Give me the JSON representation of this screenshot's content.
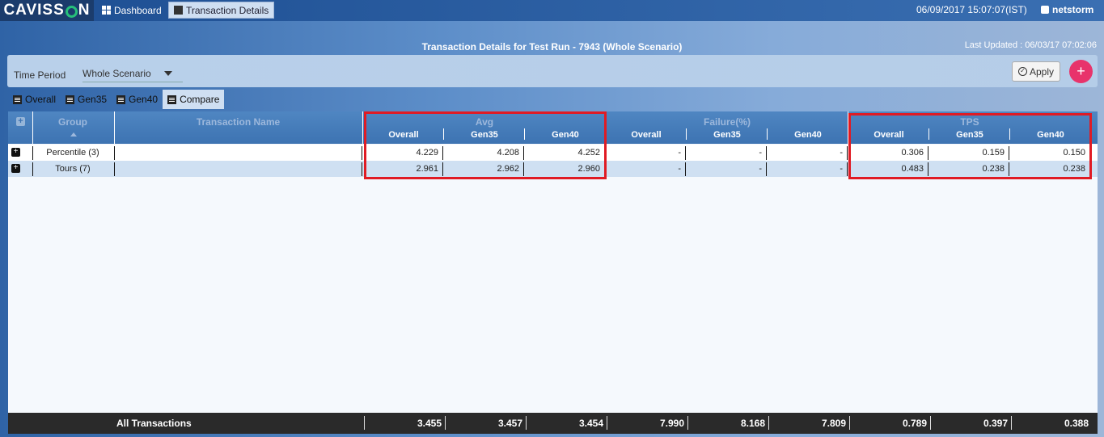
{
  "app": {
    "logo_text_1": "CAVISS",
    "logo_text_2": "N",
    "nav_tabs": [
      {
        "label": "Dashboard",
        "icon": "dashboard-grid-icon"
      },
      {
        "label": "Transaction Details",
        "icon": "comment-icon"
      }
    ],
    "datetime": "06/09/2017 15:07:07(IST)",
    "user": "netstorm"
  },
  "page": {
    "title": "Transaction Details for Test Run - 7943 (Whole Scenario)",
    "last_updated": "Last Updated : 06/03/17 07:02:06"
  },
  "filter": {
    "time_period_label": "Time Period",
    "time_period_value": "Whole Scenario",
    "apply_label": "Apply",
    "add_label": "+"
  },
  "subtabs": [
    {
      "label": "Overall"
    },
    {
      "label": "Gen35"
    },
    {
      "label": "Gen40"
    },
    {
      "label": "Compare",
      "active": true
    }
  ],
  "table": {
    "col_group": "Group",
    "col_name": "Transaction Name",
    "groups": [
      "Avg",
      "Failure(%)",
      "TPS"
    ],
    "sub_cols": [
      "Overall",
      "Gen35",
      "Gen40"
    ],
    "rows": [
      {
        "group": "Percentile (3)",
        "name": "",
        "avg": [
          "4.229",
          "4.208",
          "4.252"
        ],
        "fail": [
          "-",
          "-",
          "-"
        ],
        "tps": [
          "0.306",
          "0.159",
          "0.150"
        ]
      },
      {
        "group": "Tours (7)",
        "name": "",
        "avg": [
          "2.961",
          "2.962",
          "2.960"
        ],
        "fail": [
          "-",
          "-",
          "-"
        ],
        "tps": [
          "0.483",
          "0.238",
          "0.238"
        ]
      }
    ],
    "footer": {
      "label": "All Transactions",
      "avg": [
        "3.455",
        "3.457",
        "3.454"
      ],
      "fail": [
        "7.990",
        "8.168",
        "7.809"
      ],
      "tps": [
        "0.789",
        "0.397",
        "0.388"
      ]
    }
  },
  "colors": {
    "header_blue": "#3d73b2",
    "highlight_red": "#e01b24",
    "add_button": "#e8336b",
    "row_alt": "#cfe0f2"
  }
}
